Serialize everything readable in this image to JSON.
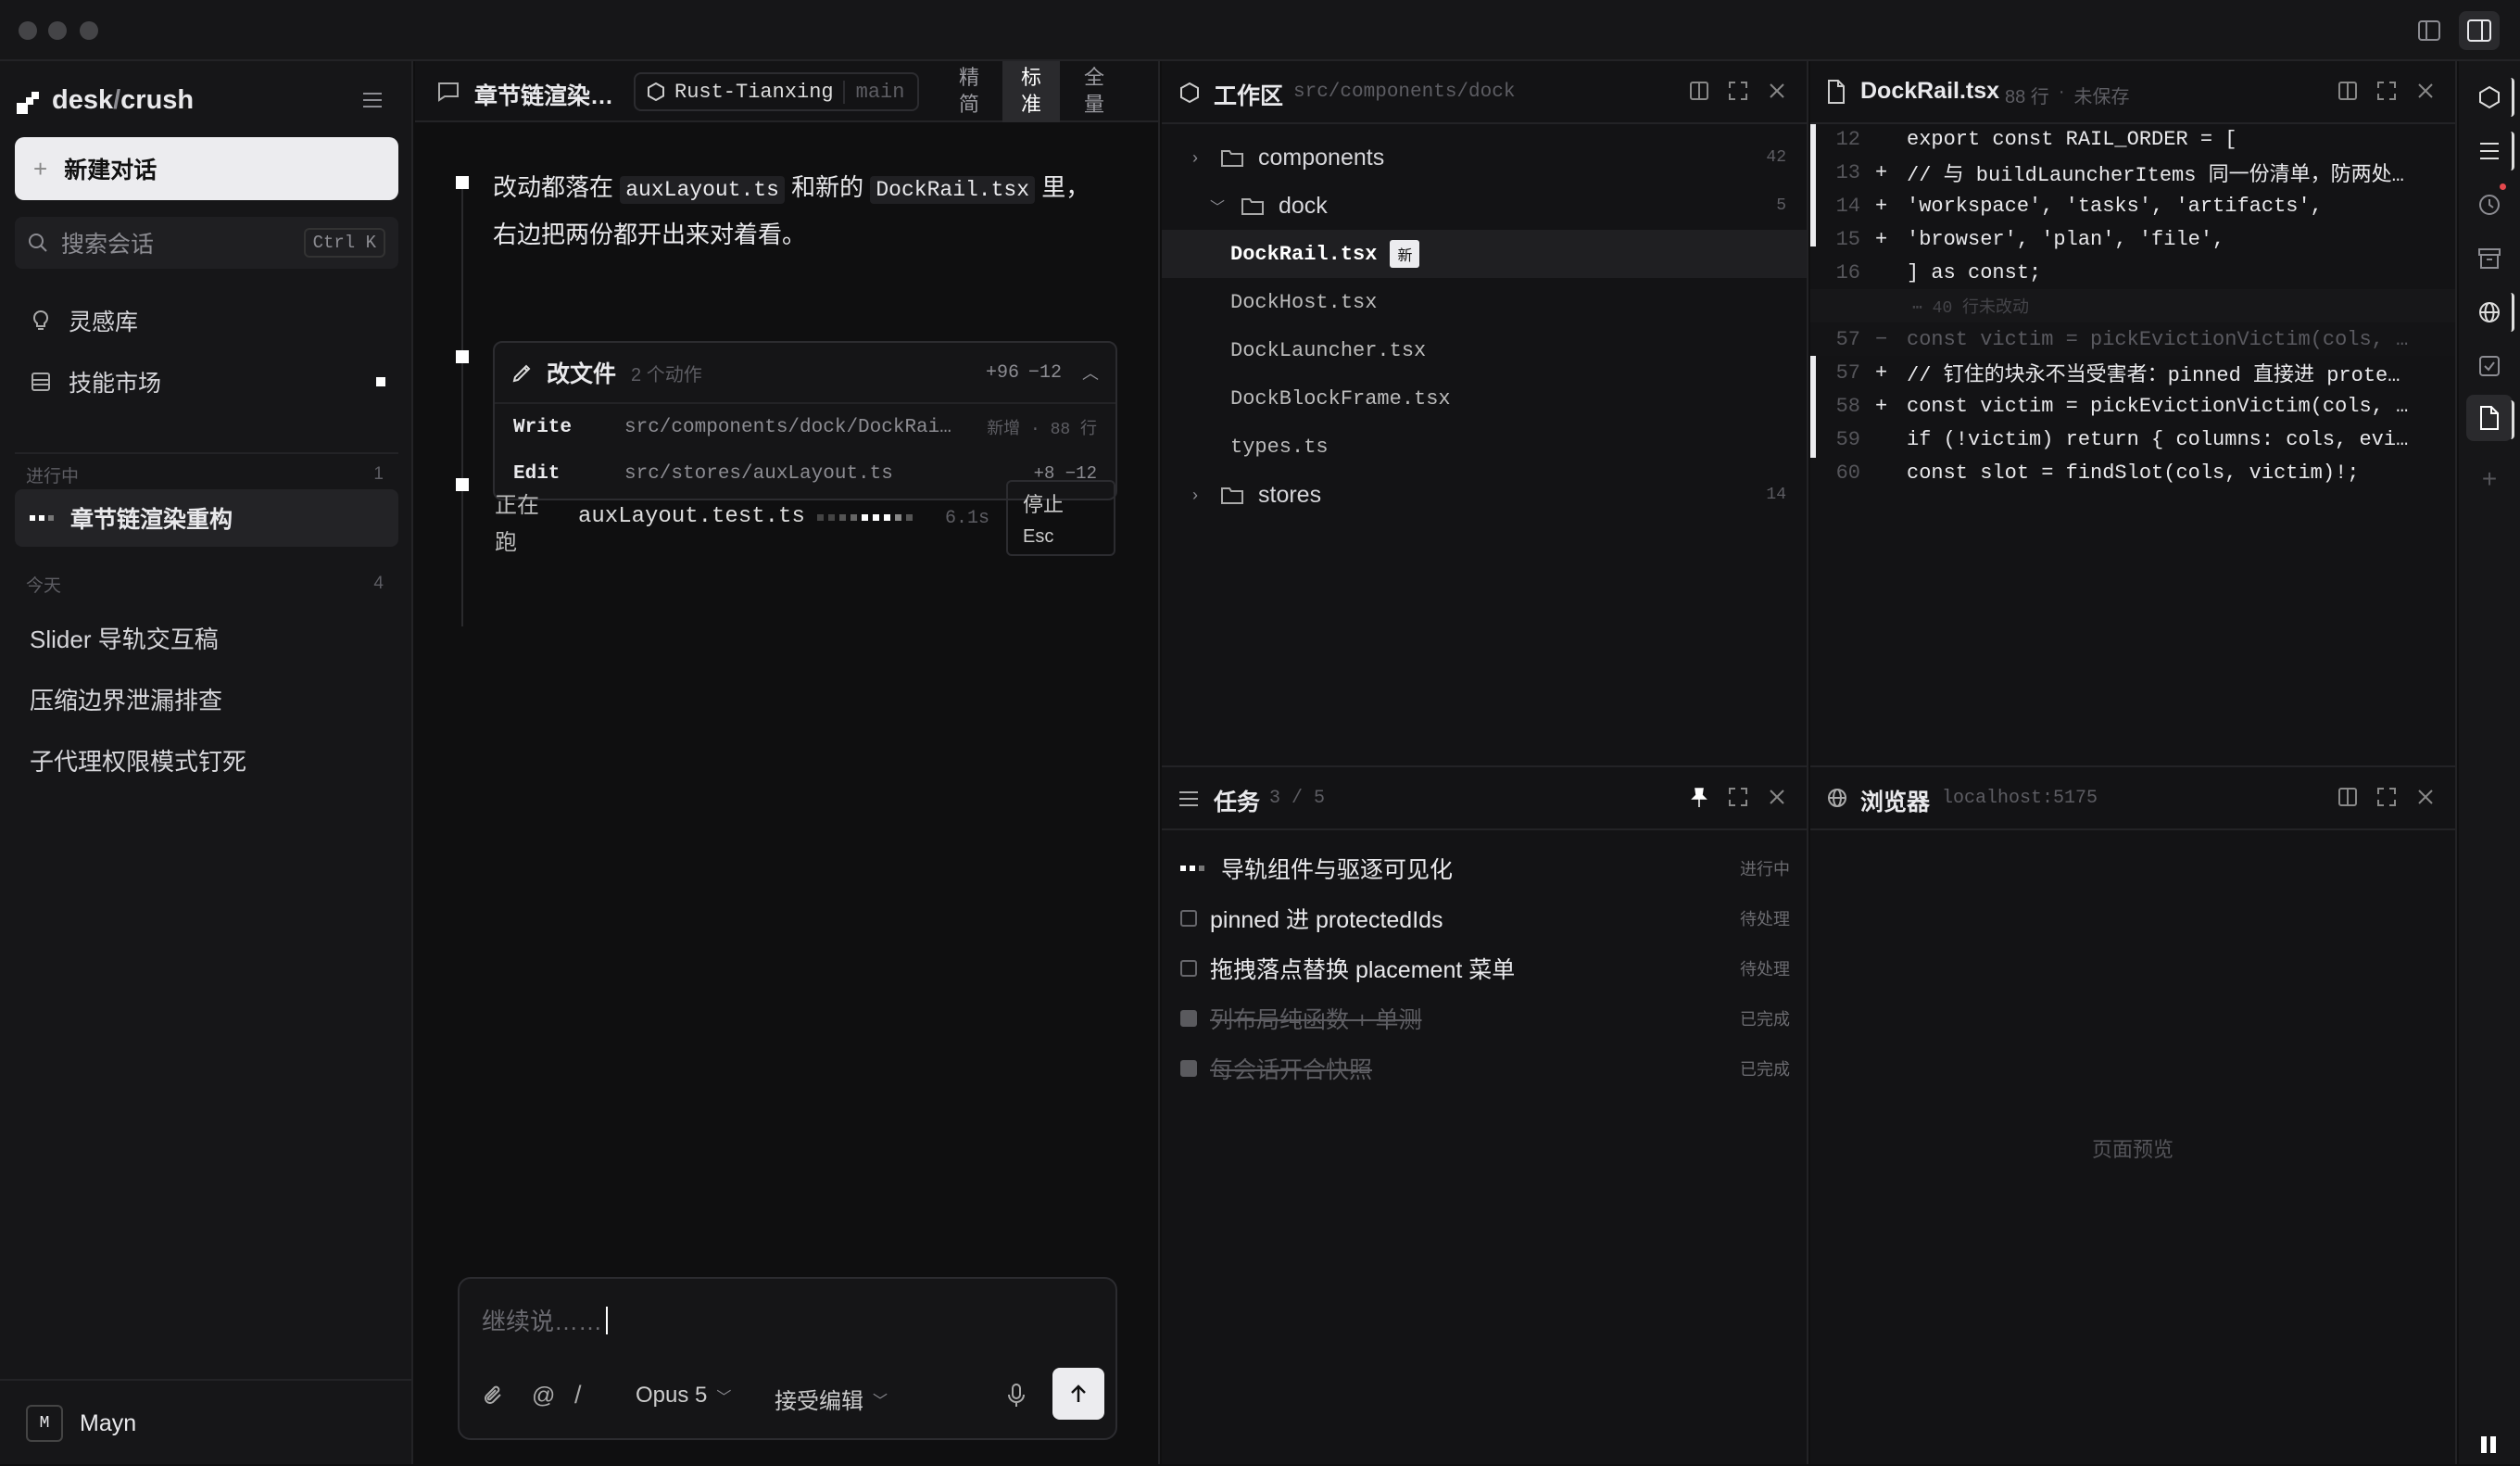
{
  "app": {
    "name_left": "desk",
    "name_sep": "/",
    "name_right": "crush"
  },
  "sidebar": {
    "new_chat": "新建对话",
    "search_placeholder": "搜索会话",
    "search_shortcut": "Ctrl K",
    "nav": [
      {
        "label": "灵感库",
        "icon": "bulb-icon"
      },
      {
        "label": "技能市场",
        "icon": "store-icon"
      }
    ],
    "groups": [
      {
        "label": "进行中",
        "count": "1",
        "items": [
          "章节链渲染重构"
        ]
      },
      {
        "label": "今天",
        "count": "4",
        "items": [
          "Slider 导轨交互稿",
          "压缩边界泄漏排查",
          "子代理权限模式钉死"
        ]
      }
    ],
    "user": {
      "initial": "M",
      "name": "Mayn"
    }
  },
  "chat": {
    "title": "章节链渲染…",
    "repo": "Rust-Tianxing",
    "branch": "main",
    "modes": [
      "精简",
      "标准",
      "全量"
    ],
    "message": {
      "p1": "改动都落在",
      "code1": "auxLayout.ts",
      "p2": "和新的",
      "code2": "DockRail.tsx",
      "p3": "里，",
      "line2": "右边把两份都开出来对着看。"
    },
    "edit_card": {
      "title": "改文件",
      "count": "2 个动作",
      "added": "+96",
      "removed": "−12",
      "rows": [
        {
          "op": "Write",
          "path": "src/components/dock/DockRai…",
          "meta": "新增 · 88 行"
        },
        {
          "op": "Edit",
          "path": "src/stores/auxLayout.ts",
          "meta": "+8 −12"
        }
      ]
    },
    "running": {
      "label": "正在跑",
      "file": "auxLayout.test.ts",
      "time": "6.1s",
      "stop": "停止",
      "stop_key": "Esc"
    },
    "composer": {
      "placeholder": "继续说……",
      "model": "Opus 5",
      "mode": "接受编辑",
      "at": "@",
      "slash": "/"
    }
  },
  "workspace": {
    "title": "工作区",
    "path": "src/components/dock",
    "tree": [
      {
        "name": "components",
        "type": "folder",
        "count": "42",
        "expanded": false
      },
      {
        "name": "dock",
        "type": "folder",
        "count": "5",
        "expanded": true
      },
      {
        "name": "DockRail.tsx",
        "type": "file",
        "badge": "新",
        "selected": true
      },
      {
        "name": "DockHost.tsx",
        "type": "file"
      },
      {
        "name": "DockLauncher.tsx",
        "type": "file"
      },
      {
        "name": "DockBlockFrame.tsx",
        "type": "file"
      },
      {
        "name": "types.ts",
        "type": "file"
      },
      {
        "name": "stores",
        "type": "folder",
        "count": "14",
        "expanded": false
      }
    ]
  },
  "editor": {
    "file": "DockRail.tsx",
    "lines": "88 行",
    "status": "未保存",
    "code": [
      {
        "n": "12",
        "m": "",
        "t": "export const RAIL_ORDER = ["
      },
      {
        "n": "13",
        "m": "+",
        "t": "  // 与 buildLauncherItems 同一份清单，防两处…"
      },
      {
        "n": "14",
        "m": "+",
        "t": "  'workspace', 'tasks', 'artifacts',"
      },
      {
        "n": "15",
        "m": "+",
        "t": "  'browser', 'plan', 'file',"
      },
      {
        "n": "16",
        "m": "",
        "t": "] as const;"
      },
      {
        "n": "",
        "m": "",
        "t": "⋯ 40 行未改动",
        "fold": true
      },
      {
        "n": "57",
        "m": "−",
        "t": "  const victim = pickEvictionVictim(cols, …",
        "del": true
      },
      {
        "n": "57",
        "m": "+",
        "t": "  // 钉住的块永不当受害者：pinned 直接进 prote…"
      },
      {
        "n": "58",
        "m": "+",
        "t": "  const victim = pickEvictionVictim(cols, …"
      },
      {
        "n": "59",
        "m": "",
        "t": "  if (!victim) return { columns: cols, evi…"
      },
      {
        "n": "60",
        "m": "",
        "t": "  const slot = findSlot(cols, victim)!;"
      }
    ]
  },
  "tasks": {
    "title": "任务",
    "progress": "3 / 5",
    "items": [
      {
        "label": "导轨组件与驱逐可见化",
        "status": "进行中",
        "state": "active"
      },
      {
        "label": "pinned 进 protectedIds",
        "status": "待处理",
        "state": "todo"
      },
      {
        "label": "拖拽落点替换 placement 菜单",
        "status": "待处理",
        "state": "todo"
      },
      {
        "label": "列布局纯函数 + 单测",
        "status": "已完成",
        "state": "done"
      },
      {
        "label": "每会话开合快照",
        "status": "已完成",
        "state": "done"
      }
    ]
  },
  "browser": {
    "title": "浏览器",
    "url": "localhost:5175",
    "placeholder": "页面预览"
  }
}
